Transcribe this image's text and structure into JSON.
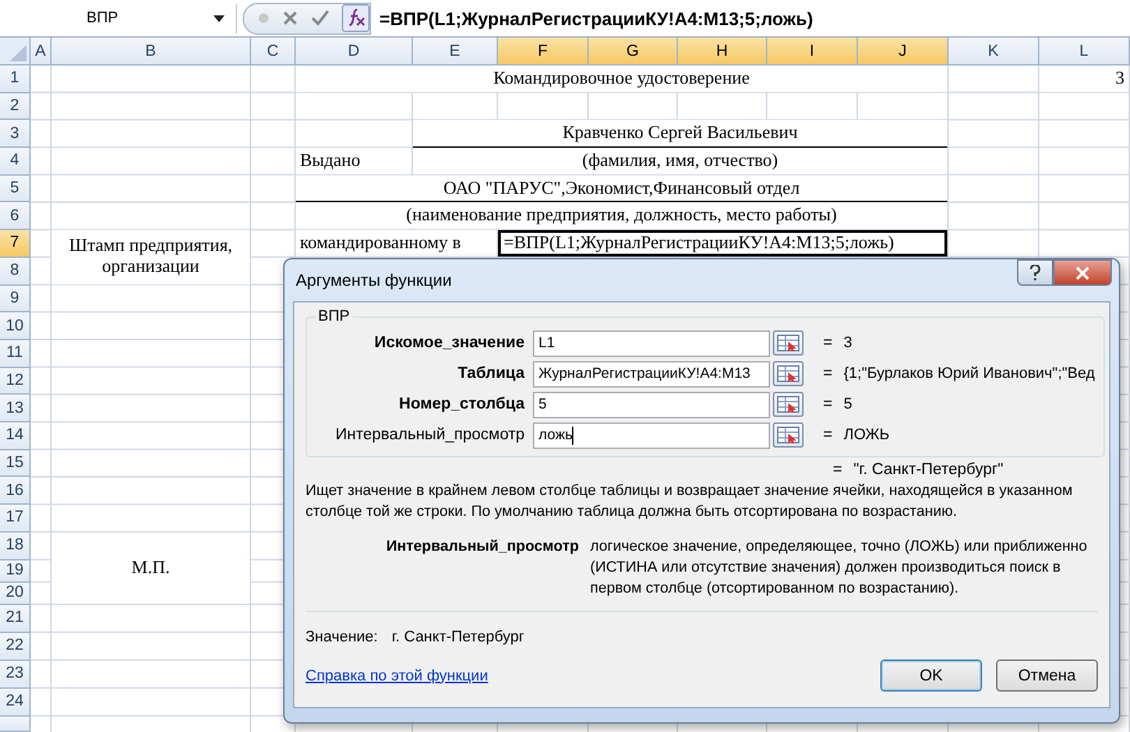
{
  "formula_bar": {
    "name_box": "ВПР",
    "formula": "=ВПР(L1;ЖурналРегистрацииКУ!A4:M13;5;ложь)"
  },
  "sheet": {
    "columns": [
      {
        "label": "A",
        "selected": false
      },
      {
        "label": "B",
        "selected": false
      },
      {
        "label": "C",
        "selected": false
      },
      {
        "label": "D",
        "selected": false
      },
      {
        "label": "E",
        "selected": false
      },
      {
        "label": "F",
        "selected": true
      },
      {
        "label": "G",
        "selected": true
      },
      {
        "label": "H",
        "selected": true
      },
      {
        "label": "I",
        "selected": true
      },
      {
        "label": "J",
        "selected": true
      },
      {
        "label": "K",
        "selected": false
      },
      {
        "label": "L",
        "selected": false
      }
    ],
    "rows": [
      {
        "label": "1",
        "selected": false
      },
      {
        "label": "2",
        "selected": false
      },
      {
        "label": "3",
        "selected": false
      },
      {
        "label": "4",
        "selected": false
      },
      {
        "label": "5",
        "selected": false
      },
      {
        "label": "6",
        "selected": false
      },
      {
        "label": "7",
        "selected": true
      },
      {
        "label": "8",
        "selected": false
      },
      {
        "label": "9",
        "selected": false
      },
      {
        "label": "10",
        "selected": false
      },
      {
        "label": "11",
        "selected": false
      },
      {
        "label": "12",
        "selected": false
      },
      {
        "label": "13",
        "selected": false
      },
      {
        "label": "14",
        "selected": false
      },
      {
        "label": "15",
        "selected": false
      },
      {
        "label": "16",
        "selected": false
      },
      {
        "label": "17",
        "selected": false
      },
      {
        "label": "18",
        "selected": false
      },
      {
        "label": "19",
        "selected": false
      },
      {
        "label": "20",
        "selected": false
      },
      {
        "label": "21",
        "selected": false
      },
      {
        "label": "22",
        "selected": false
      },
      {
        "label": "23",
        "selected": false
      },
      {
        "label": "24",
        "selected": false
      }
    ],
    "cells": [
      {
        "text": "Командировочное удостоверение",
        "selected": false
      },
      {
        "text": "3",
        "selected": false
      },
      {
        "text": "Кравченко Сергей Васильевич",
        "selected": false
      },
      {
        "text": "Выдано",
        "selected": false
      },
      {
        "text": "(фамилия, имя, отчество)",
        "selected": false
      },
      {
        "text": "ОАО \"ПАРУС\",Экономист,Финансовый отдел",
        "selected": false
      },
      {
        "text": "(наименование предприятия, должность, место работы)",
        "selected": false
      },
      {
        "text": "Штамп предприятия, организации",
        "selected": false
      },
      {
        "text": "командированному в",
        "selected": false
      },
      {
        "text": "=ВПР(L1;ЖурналРегистрацииКУ!A4:M13;5;ложь)",
        "selected": true
      },
      {
        "text": "М.П.",
        "selected": false
      }
    ]
  },
  "dialog": {
    "title": "Аргументы функции",
    "function": "ВПР",
    "arguments": [
      {
        "name": "Искомое_значение",
        "required": true,
        "value": "L1",
        "equals": "=",
        "result": "3"
      },
      {
        "name": "Таблица",
        "required": true,
        "value": "ЖурналРегистрацииКУ!A4:M13",
        "equals": "=",
        "result": "{1;\"Бурлаков Юрий Иванович\";\"Вед"
      },
      {
        "name": "Номер_столбца",
        "required": true,
        "value": "5",
        "equals": "=",
        "result": "5"
      },
      {
        "name": "Интервальный_просмотр",
        "required": false,
        "value": "ложь",
        "equals": "=",
        "result": "ЛОЖЬ"
      }
    ],
    "formula_result_equals": "=",
    "formula_result": "\"г. Санкт-Петербург\"",
    "description": "Ищет значение в крайнем левом столбце таблицы и возвращает значение ячейки, находящейся в указанном столбце той же строки. По умолчанию таблица должна быть отсортирована по возрастанию.",
    "argument_help": {
      "name": "Интервальный_просмотр",
      "text": "логическое значение, определяющее, точно (ЛОЖЬ) или приближенно (ИСТИНА или отсутствие значения) должен производиться поиск в первом столбце (отсортированном по возрастанию)."
    },
    "value_label": "Значение:",
    "value": "г. Санкт-Петербург",
    "help_link": "Справка по этой функции",
    "buttons": [
      "OK",
      "Отмена"
    ]
  }
}
